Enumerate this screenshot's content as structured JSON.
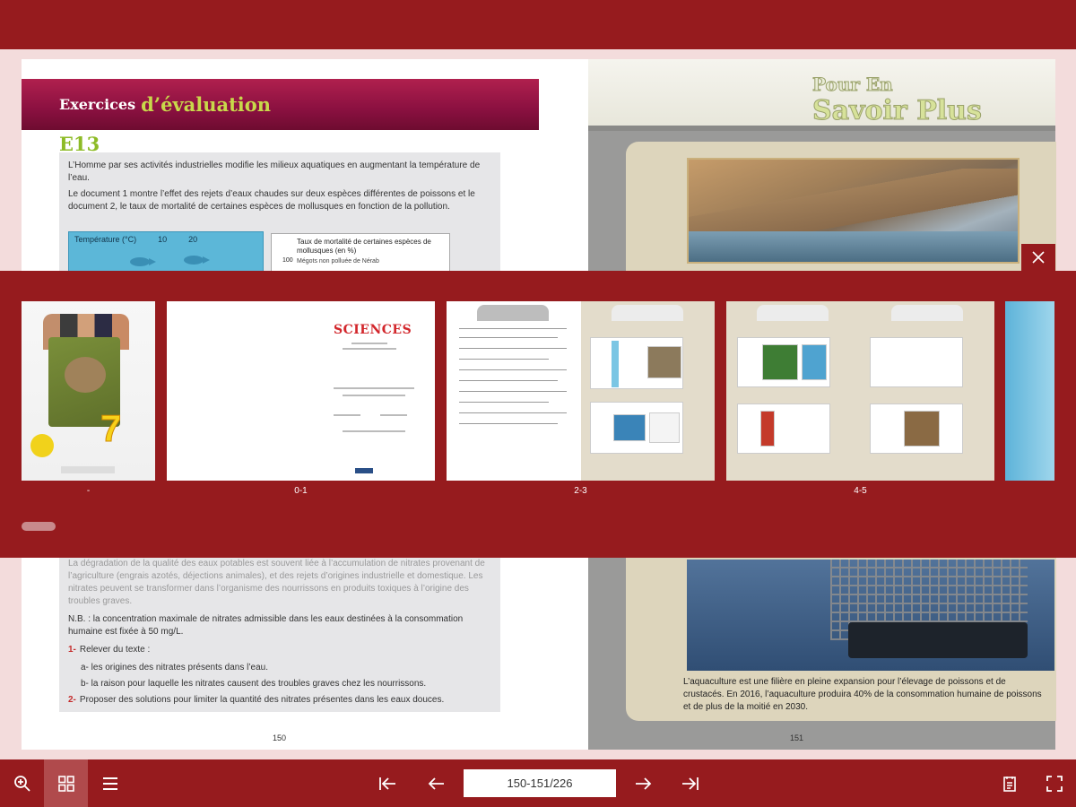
{
  "left_page": {
    "banner_part1": "Exercices",
    "banner_part2": "d’évaluation",
    "exercise_code": "E13",
    "intro_p1": "L’Homme par ses activités industrielles modifie les milieux aquatiques en augmentant la température de l’eau.",
    "intro_p2": "Le document 1 montre l’effet des rejets d’eaux chaudes sur deux espèces différentes de poissons et le document 2, le taux de mortalité de certaines espèces de mollusques en fonction de la pollution.",
    "doc1_header_label": "Température (°C)",
    "doc1_val1": "10",
    "doc1_val2": "20",
    "doc2_title": "Taux de mortalité de certaines espèces de mollusques (en %)",
    "doc2_axis": "100",
    "doc2_legend": "Mégots non polluée de Nérab",
    "lower_p1": "La dégradation de la qualité des eaux potables est souvent liée à l’accumulation de nitrates provenant de l’agriculture (engrais azotés, déjections animales), et des rejets d’origines industrielle et domestique. Les nitrates peuvent se transformer dans l’organisme des nourrissons en produits toxiques à l’origine des troubles graves.",
    "lower_nb": "N.B. : la concentration maximale de nitrates admissible dans les eaux destinées à la consommation humaine est fixée à 50 mg/L.",
    "q1_num": "1-",
    "q1_text": "Relever du texte :",
    "q1a": "a- les origines des nitrates présents dans l’eau.",
    "q1b": "b- la raison pour laquelle les nitrates causent des troubles graves chez les nourrissons.",
    "q2_num": "2-",
    "q2_text": "Proposer des solutions pour limiter la quantité des nitrates présentes dans les eaux douces.",
    "page_number": "150"
  },
  "right_page": {
    "title_line1": "Pour En",
    "title_line2": "Savoir Plus",
    "caption": "L’aquaculture est une filière en pleine expansion pour l’élevage de poissons et de crustacés. En 2016, l’aquaculture produira 40% de la consommation humaine de poissons et de plus de la moitié en 2030.",
    "page_number": "151"
  },
  "thumbnails": {
    "items": [
      {
        "label": "-"
      },
      {
        "label": "0-1",
        "brand": "SCIENCES"
      },
      {
        "label": "2-3"
      },
      {
        "label": "4-5"
      }
    ]
  },
  "toolbar": {
    "page_indicator": "150-151/226"
  },
  "colors": {
    "brand_red": "#961b1e",
    "banner_magenta": "#8a1040",
    "accent_green": "#8dbb26"
  },
  "icons": {
    "zoom": "zoom-in-icon",
    "thumbnails": "grid-icon",
    "outline": "list-icon",
    "first": "first-page-icon",
    "prev": "prev-page-icon",
    "next": "next-page-icon",
    "last": "last-page-icon",
    "notes": "notes-icon",
    "fullscreen": "fullscreen-icon",
    "close": "close-icon"
  }
}
